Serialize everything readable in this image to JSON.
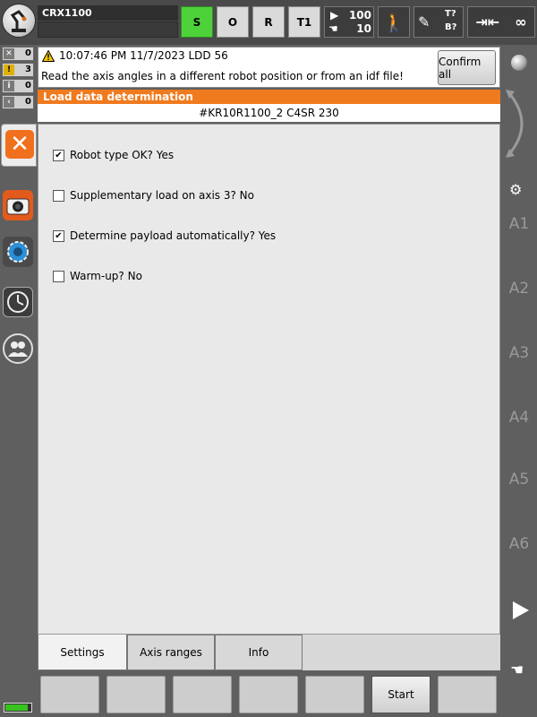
{
  "header": {
    "robot_name": "CRX1100",
    "status_s": "S",
    "status_o": "O",
    "status_r": "R",
    "status_t1": "T1",
    "program_override": "100",
    "jog_override": "10",
    "tool_t": "T?",
    "tool_b": "B?",
    "increment_infinity": "∞"
  },
  "messages": {
    "counters": [
      {
        "icon": "✕",
        "value": "0",
        "color": "#7a7a7a"
      },
      {
        "icon": "!",
        "value": "3",
        "color": "#e0b000"
      },
      {
        "icon": "i",
        "value": "0",
        "color": "#7a7a7a"
      },
      {
        "icon": "‹",
        "value": "0",
        "color": "#7a7a7a"
      }
    ],
    "time_line": "10:07:46 PM 11/7/2023 LDD 56",
    "text": "Read the axis angles in a different robot position or from an idf file!",
    "confirm_all_label": "Confirm all"
  },
  "window": {
    "title": "Load data determination",
    "subtitle": "#KR10R1100_2 C4SR 230"
  },
  "options": [
    {
      "label": "Robot type OK? Yes",
      "checked": true
    },
    {
      "label": "Supplementary load on axis 3? No",
      "checked": false
    },
    {
      "label": "Determine payload automatically? Yes",
      "checked": true
    },
    {
      "label": "Warm-up? No",
      "checked": false
    }
  ],
  "tabs": [
    "Settings",
    "Axis ranges",
    "Info"
  ],
  "softkeys": [
    "",
    "",
    "",
    "",
    "",
    "Start",
    ""
  ],
  "axes": [
    "A1",
    "A2",
    "A3",
    "A4",
    "A5",
    "A6"
  ],
  "battery_level": 0.9,
  "colors": {
    "accent_orange": "#f07a1e",
    "status_green": "#4ed23a"
  }
}
